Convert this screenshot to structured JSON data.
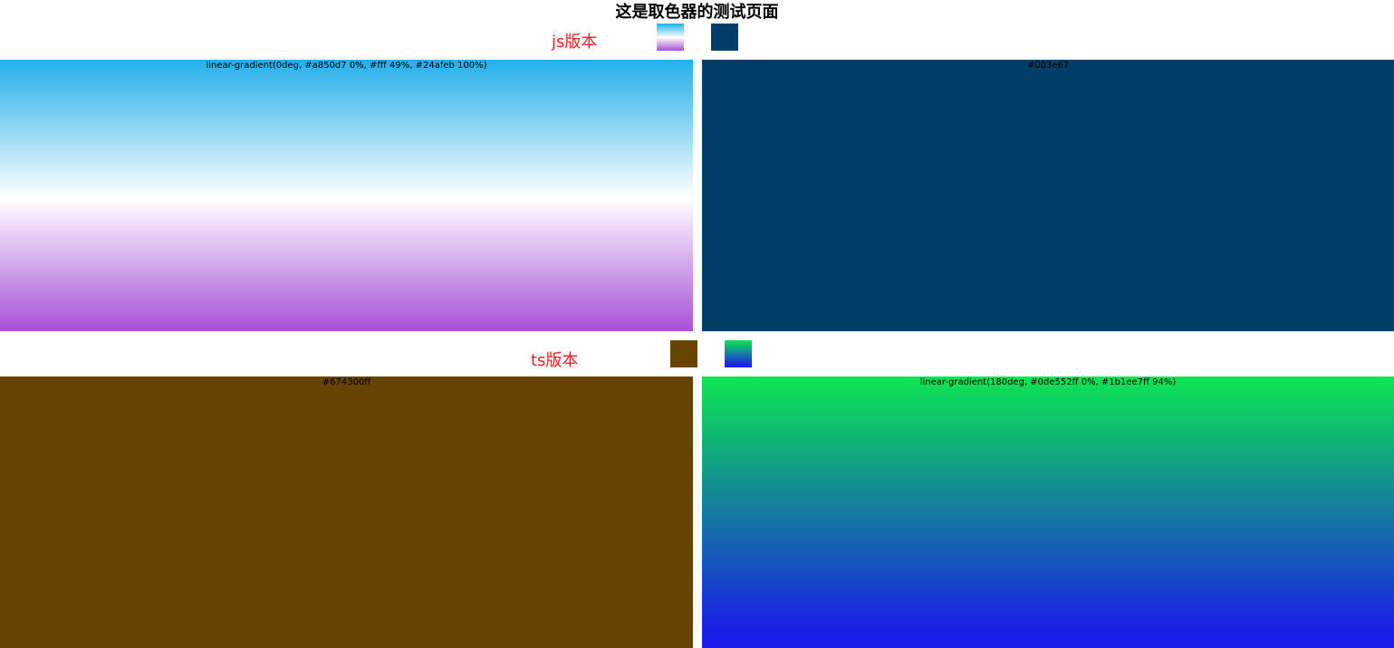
{
  "page": {
    "title": "这是取色器的测试页面"
  },
  "js_section": {
    "label": "js版本",
    "swatches": [
      {
        "name": "gradient-swatch",
        "value": "linear-gradient(0deg, #a850d7 0%, #fff 49%, #24afeb 100%)"
      },
      {
        "name": "solid-swatch",
        "value": "#003e67"
      }
    ],
    "panels": [
      {
        "value_text": "linear-gradient(0deg, #a850d7 0%, #fff 49%, #24afeb 100%)",
        "background": "linear-gradient(0deg, #a850d7 0%, #fff 49%, #24afeb 100%)"
      },
      {
        "value_text": "#003e67",
        "background": "#003e67"
      }
    ]
  },
  "ts_section": {
    "label": "ts版本",
    "swatches": [
      {
        "name": "solid-swatch",
        "value": "#674300ff"
      },
      {
        "name": "gradient-swatch",
        "value": "linear-gradient(180deg, #0de552ff 0%, #1b1ee7ff 94%)"
      }
    ],
    "panels": [
      {
        "value_text": "#674300ff",
        "background": "#674300ff"
      },
      {
        "value_text": "linear-gradient(180deg, #0de552ff 0%, #1b1ee7ff 94%)",
        "background": "linear-gradient(180deg, #0de552ff 0%, #1b1ee7ff 94%)"
      }
    ]
  },
  "colors": {
    "label_red": "#e5202a"
  }
}
